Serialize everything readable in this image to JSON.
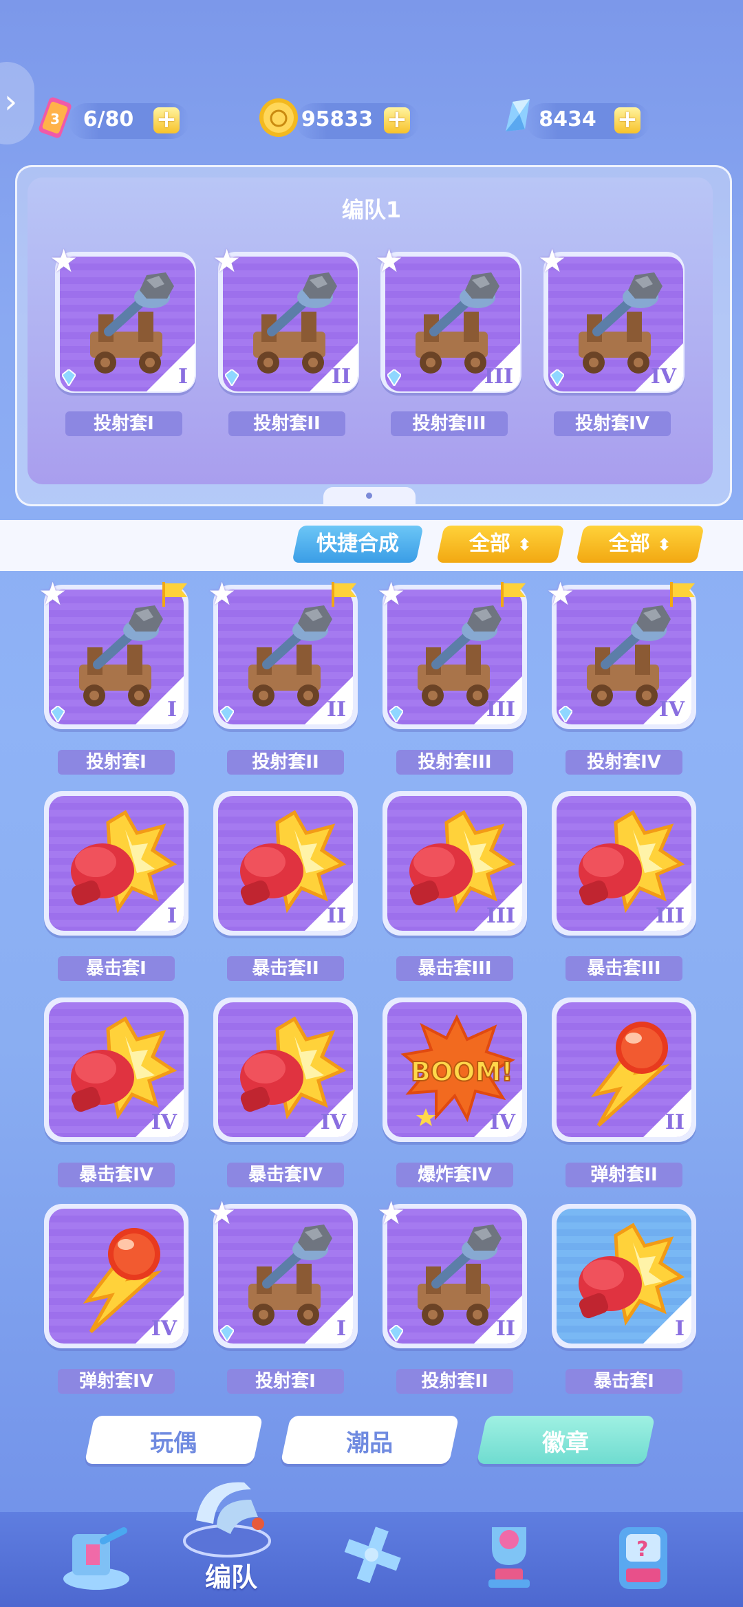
{
  "resources": [
    {
      "name": "tickets",
      "value": "6/80",
      "icon": "ticket-icon"
    },
    {
      "name": "coins",
      "value": "95833",
      "icon": "coin-icon"
    },
    {
      "name": "crystals",
      "value": "8434",
      "icon": "crystal-icon"
    }
  ],
  "plus_label": "+",
  "team": {
    "title": "编队1",
    "slots": [
      {
        "name": "投射套I",
        "tier": "I",
        "art": "catapult"
      },
      {
        "name": "投射套II",
        "tier": "II",
        "art": "catapult"
      },
      {
        "name": "投射套III",
        "tier": "III",
        "art": "catapult"
      },
      {
        "name": "投射套IV",
        "tier": "IV",
        "art": "catapult"
      }
    ]
  },
  "toolbar": {
    "quick_merge": "快捷合成",
    "filter1": "全部",
    "filter2": "全部"
  },
  "inventory": [
    {
      "name": "投射套I",
      "tier": "I",
      "art": "catapult",
      "flag": true
    },
    {
      "name": "投射套II",
      "tier": "II",
      "art": "catapult",
      "flag": true
    },
    {
      "name": "投射套III",
      "tier": "III",
      "art": "catapult",
      "flag": true
    },
    {
      "name": "投射套IV",
      "tier": "IV",
      "art": "catapult",
      "flag": true
    },
    {
      "name": "暴击套I",
      "tier": "I",
      "art": "glove"
    },
    {
      "name": "暴击套II",
      "tier": "II",
      "art": "glove"
    },
    {
      "name": "暴击套III",
      "tier": "III",
      "art": "glove"
    },
    {
      "name": "暴击套III",
      "tier": "III",
      "art": "glove"
    },
    {
      "name": "暴击套IV",
      "tier": "IV",
      "art": "glove"
    },
    {
      "name": "暴击套IV",
      "tier": "IV",
      "art": "glove"
    },
    {
      "name": "爆炸套IV",
      "tier": "IV",
      "art": "boom"
    },
    {
      "name": "弹射套II",
      "tier": "II",
      "art": "ball"
    },
    {
      "name": "弹射套IV",
      "tier": "IV",
      "art": "ball"
    },
    {
      "name": "投射套I",
      "tier": "I",
      "art": "catapult"
    },
    {
      "name": "投射套II",
      "tier": "II",
      "art": "catapult"
    },
    {
      "name": "暴击套I",
      "tier": "I",
      "art": "glove",
      "blue": true
    }
  ],
  "boom_text": "BOOM!",
  "bottom_tabs": [
    "玩偶",
    "潮品",
    "徽章"
  ],
  "nav": {
    "active_label": "编队"
  }
}
